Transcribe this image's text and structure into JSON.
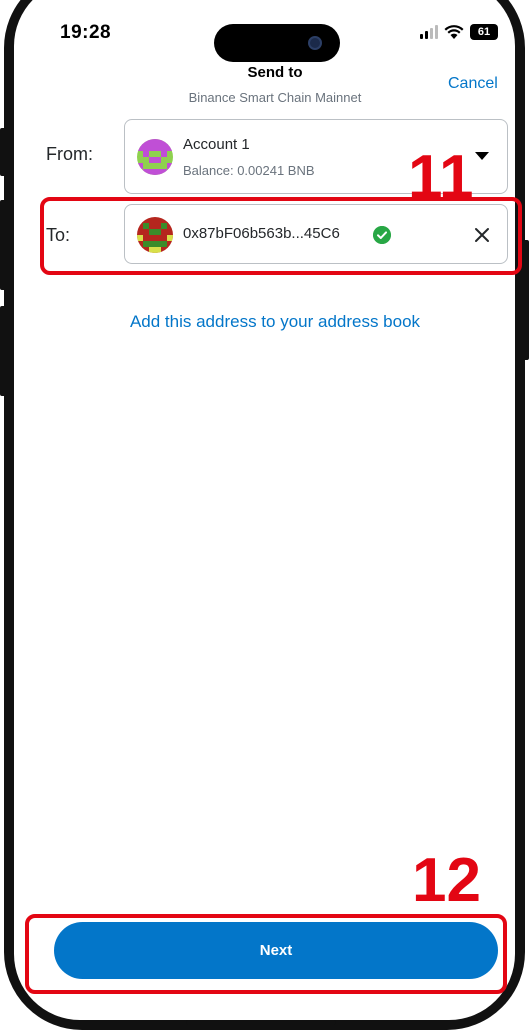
{
  "status_bar": {
    "time": "19:28",
    "battery": "61"
  },
  "header": {
    "title": "Send to",
    "subtitle": "Binance Smart Chain Mainnet",
    "cancel_label": "Cancel"
  },
  "from": {
    "label": "From:",
    "account_name": "Account 1",
    "balance": "Balance: 0.00241 BNB"
  },
  "to": {
    "label": "To:",
    "address": "0x87bF06b563b...45C6"
  },
  "add_address_link": "Add this address to your address book",
  "next_label": "Next",
  "annotations": [
    "11",
    "12"
  ],
  "colors": {
    "accent": "#0376c9",
    "annotation": "#e30613",
    "verified": "#28a745"
  }
}
